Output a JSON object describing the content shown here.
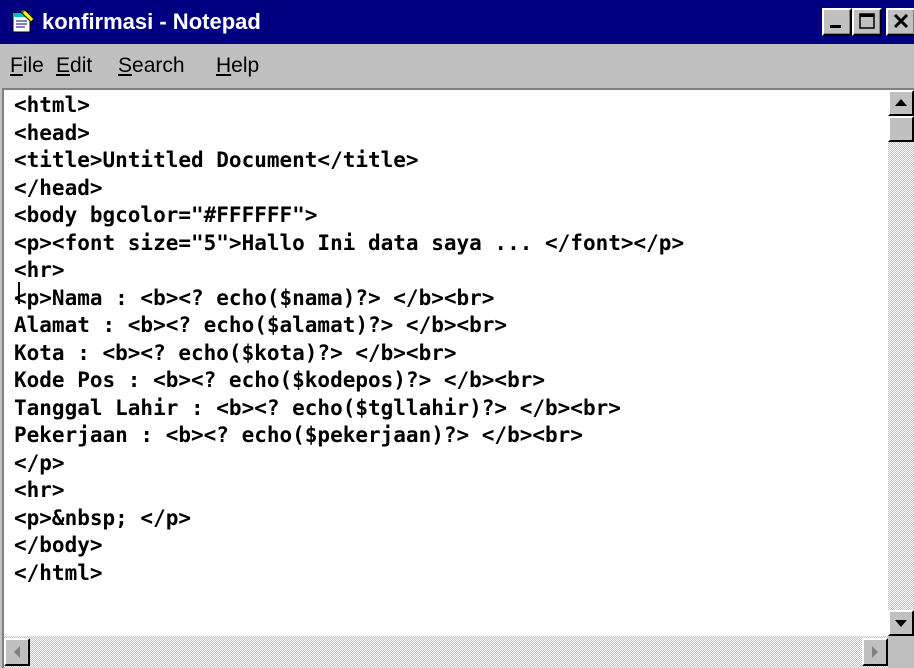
{
  "window": {
    "title": "konfirmasi - Notepad",
    "icon": "notepad-icon",
    "controls": {
      "minimize": "minimize-icon",
      "maximize": "maximize-icon",
      "close": "close-icon"
    }
  },
  "menu": {
    "file": {
      "access_key": "F",
      "rest": "ile"
    },
    "edit": {
      "access_key": "E",
      "rest": "dit"
    },
    "search": {
      "access_key": "S",
      "rest": "earch"
    },
    "help": {
      "access_key": "H",
      "rest": "elp"
    }
  },
  "editor": {
    "lines": [
      "<html>",
      "<head>",
      "<title>Untitled Document</title>",
      "</head>",
      "<body bgcolor=\"#FFFFFF\">",
      "<p><font size=\"5\">Hallo Ini data saya ... </font></p>",
      "<hr>",
      "<p>Nama : <b><? echo($nama)?> </b><br>",
      "Alamat : <b><? echo($alamat)?> </b><br>",
      "Kota : <b><? echo($kota)?> </b><br>",
      "Kode Pos : <b><? echo($kodepos)?> </b><br>",
      "Tanggal Lahir : <b><? echo($tgllahir)?> </b><br>",
      "Pekerjaan : <b><? echo($pekerjaan)?> </b><br>",
      "</p>",
      "<hr>",
      "<p>&nbsp; </p>",
      "</body>",
      "</html>"
    ]
  },
  "scrollbars": {
    "vertical": {
      "up": "scroll-up-arrow-icon",
      "down": "scroll-down-arrow-icon",
      "position_fraction": 0.0
    },
    "horizontal": {
      "left": "scroll-left-arrow-icon",
      "right": "scroll-right-arrow-icon"
    }
  },
  "colors": {
    "titlebar": "#000080",
    "chrome": "#c0c0c0",
    "text": "#000000",
    "editor_bg": "#ffffff"
  }
}
